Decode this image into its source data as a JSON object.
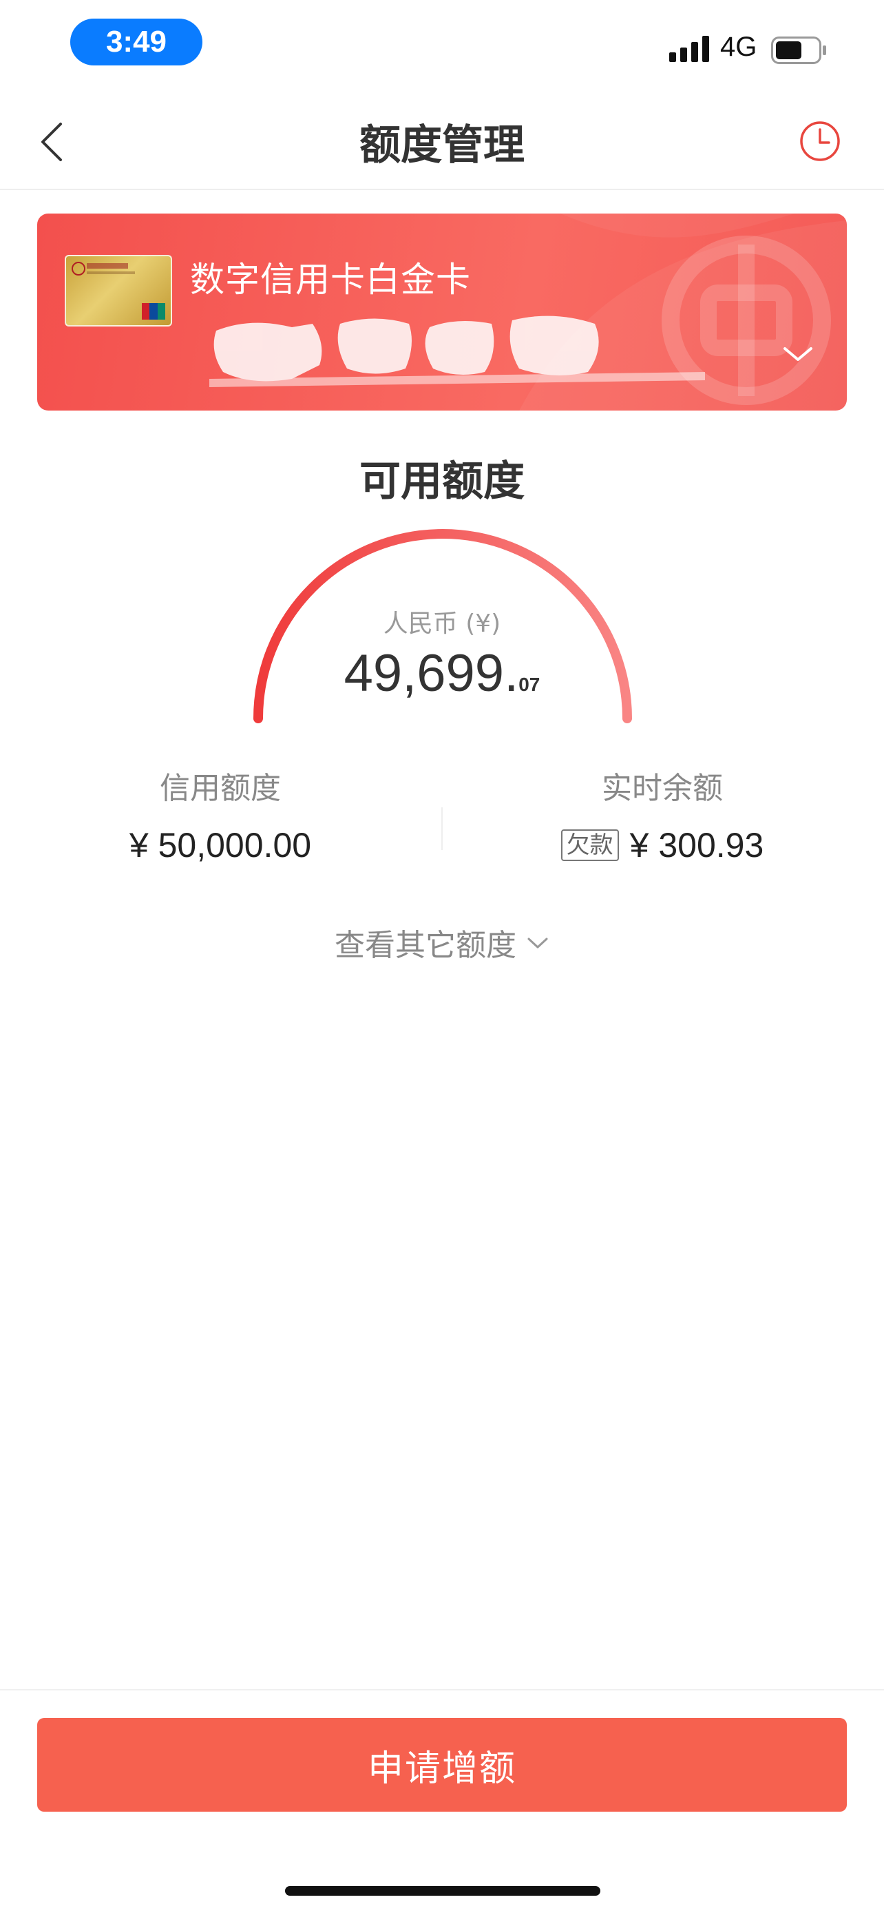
{
  "status_bar": {
    "time": "3:49",
    "network": "4G",
    "battery_level": 0.6
  },
  "nav": {
    "title": "额度管理",
    "back_icon": "chevron-left-icon",
    "history_icon": "clock-icon"
  },
  "card": {
    "name": "数字信用卡白金卡",
    "thumbnail_icon": "credit-card-icon",
    "number_masked": true,
    "expand_icon": "chevron-down-icon"
  },
  "available": {
    "title": "可用额度",
    "currency_label": "人民币 (¥)",
    "amount_integer": "49,699.",
    "amount_decimal": "07"
  },
  "limits": {
    "credit_label": "信用额度",
    "credit_value": "¥ 50,000.00",
    "balance_label": "实时余额",
    "balance_badge": "欠款",
    "balance_value": "¥ 300.93"
  },
  "other": {
    "label": "查看其它额度"
  },
  "actions": {
    "apply_label": "申请增额"
  },
  "colors": {
    "brand_red": "#f6614f",
    "banner_red": "#f3504d",
    "status_pill_blue": "#0a7cff",
    "text_primary": "#333333",
    "text_secondary": "#888888"
  }
}
